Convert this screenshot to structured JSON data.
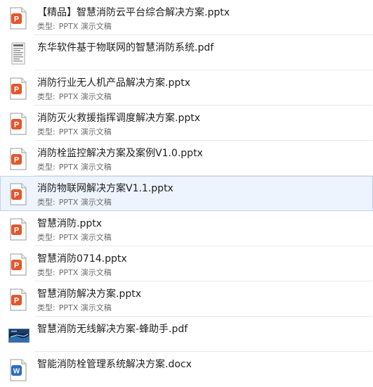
{
  "files": [
    {
      "name": "【精品】智慧消防云平台综合解决方案.pptx",
      "type_label": "类型:",
      "type_value": "PPTX 演示文稿",
      "icon": "pptx-file-icon"
    },
    {
      "name": "东华软件基于物联网的智慧消防系统.pdf",
      "type_label": "",
      "type_value": "",
      "icon": "pdf-file-icon"
    },
    {
      "name": "消防行业无人机产品解决方案.pptx",
      "type_label": "类型:",
      "type_value": "PPTX 演示文稿",
      "icon": "pptx-file-icon"
    },
    {
      "name": "消防灭火救援指挥调度解决方案.pptx",
      "type_label": "类型:",
      "type_value": "PPTX 演示文稿",
      "icon": "pptx-file-icon"
    },
    {
      "name": "消防栓监控解决方案及案例V1.0.pptx",
      "type_label": "类型:",
      "type_value": "PPTX 演示文稿",
      "icon": "pptx-file-icon"
    },
    {
      "name": "消防物联网解决方案V1.1.pptx",
      "type_label": "类型:",
      "type_value": "PPTX 演示文稿",
      "icon": "pptx-file-icon"
    },
    {
      "name": "智慧消防.pptx",
      "type_label": "类型:",
      "type_value": "PPTX 演示文稿",
      "icon": "pptx-file-icon"
    },
    {
      "name": "智慧消防0714.pptx",
      "type_label": "类型:",
      "type_value": "PPTX 演示文稿",
      "icon": "pptx-file-icon"
    },
    {
      "name": "智慧消防解决方案.pptx",
      "type_label": "类型:",
      "type_value": "PPTX 演示文稿",
      "icon": "pptx-file-icon"
    },
    {
      "name": "智慧消防无线解决方案-蜂助手.pdf",
      "type_label": "",
      "type_value": "",
      "icon": "pdf-thumbnail-icon"
    },
    {
      "name": "智能消防栓管理系统解决方案.docx",
      "type_label": "",
      "type_value": "",
      "icon": "docx-file-icon"
    }
  ],
  "colors": {
    "pptx_accent": "#e2572b",
    "docx_accent": "#2b6cc4",
    "selected_bg": "#eef4fd",
    "selected_border": "#bcd2f2"
  }
}
